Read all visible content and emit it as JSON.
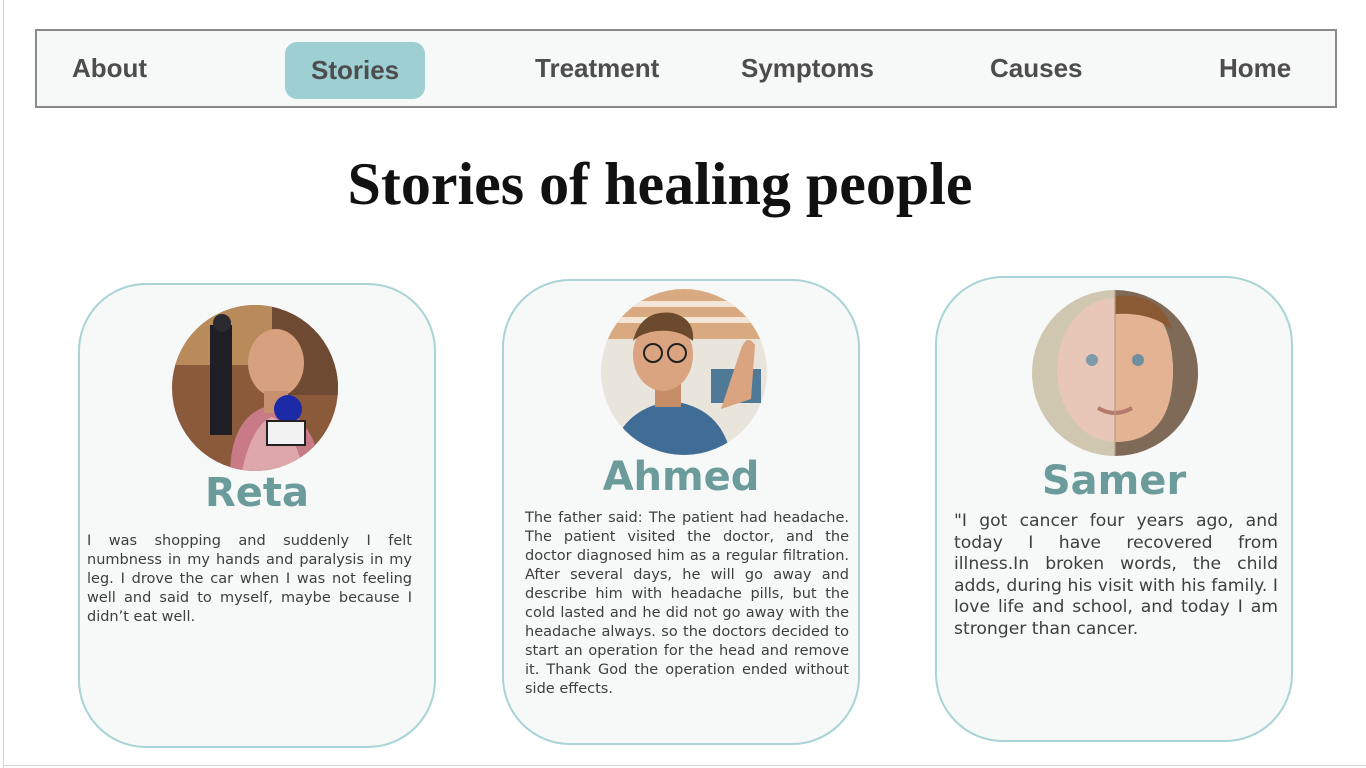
{
  "nav": {
    "items": [
      {
        "label": "About"
      },
      {
        "label": "Stories"
      },
      {
        "label": "Treatment"
      },
      {
        "label": "Symptoms"
      },
      {
        "label": "Causes"
      },
      {
        "label": "Home"
      }
    ],
    "active": "Stories",
    "accent_color": "#9ecfd2"
  },
  "page": {
    "title": "Stories of healing people"
  },
  "stories": [
    {
      "name": "Reta",
      "text": "I was shopping and suddenly I felt numbness in my hands and paralysis in my leg. I drove the car when I was not feeling well and said to myself, maybe because I didn’t eat well."
    },
    {
      "name": "Ahmed",
      "text": "The father said: The patient had  headache. The patient visited the doctor, and the doctor diagnosed him as a regular filtration. After several days, he will go away and describe him with headache pills, but the cold lasted and he did not go away with the headache always. so the doctors decided to start an operation for the head and remove it. Thank God the operation ended without side effects."
    },
    {
      "name": "Samer",
      "text": "\"I got cancer four years ago, and today I have recovered from illness.In broken words, the child adds, during his visit with his family. I love life and school, and today I am stronger than cancer."
    }
  ],
  "colors": {
    "card_border": "#a9d4d6",
    "name_color": "#6b9c9b"
  }
}
